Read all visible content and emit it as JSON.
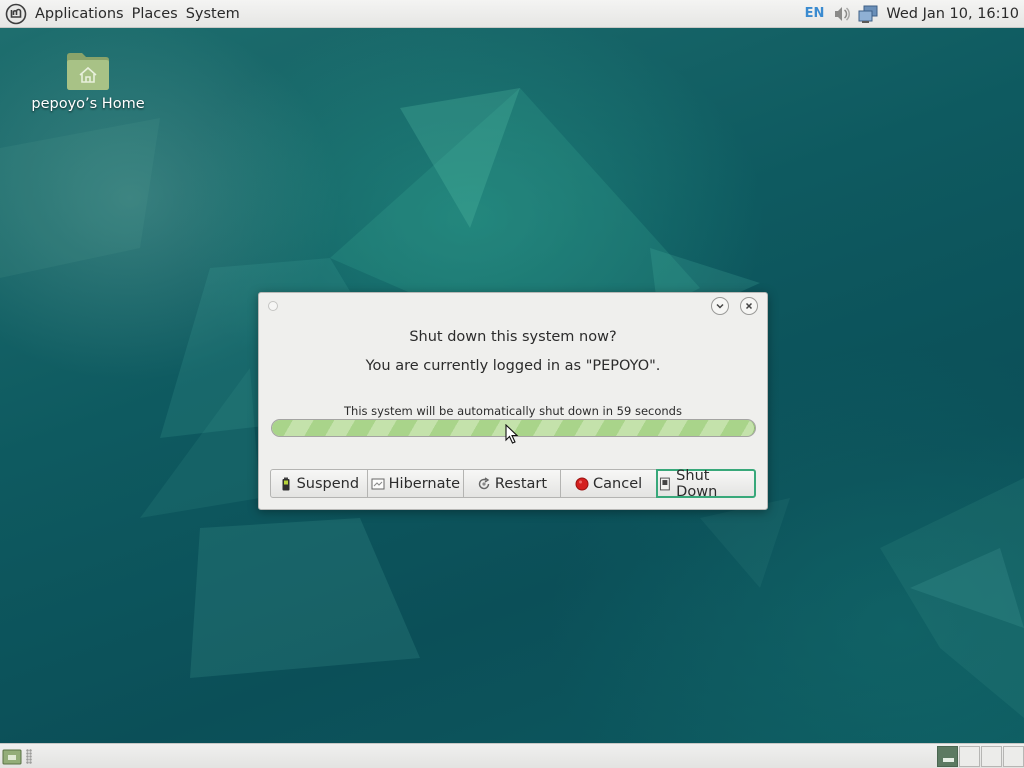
{
  "top_panel": {
    "menus": [
      "Applications",
      "Places",
      "System"
    ],
    "keyboard_layout": "EN",
    "clock": "Wed Jan 10, 16:10",
    "icons": [
      "mint-menu-icon",
      "volume-icon",
      "network-icon"
    ]
  },
  "desktop": {
    "icons": [
      {
        "label": "pepoyo’s Home",
        "icon": "home-folder-icon"
      }
    ]
  },
  "dialog": {
    "question": "Shut down this system now?",
    "logged_in_text": "You are currently logged in as \"PEPOYO\".",
    "countdown_text": "This system will be automatically shut down in 59 seconds",
    "progress_percent": 100,
    "buttons": [
      {
        "label": "Suspend",
        "icon": "suspend-battery-icon"
      },
      {
        "label": "Hibernate",
        "icon": "hibernate-icon"
      },
      {
        "label": "Restart",
        "icon": "restart-icon"
      },
      {
        "label": "Cancel",
        "icon": "cancel-red-dot-icon"
      },
      {
        "label": "Shut Down",
        "icon": "shutdown-icon",
        "default": true
      }
    ]
  },
  "bottom_panel": {
    "workspaces": 4,
    "active_workspace": 1
  },
  "colors": {
    "accent_green": "#38a87a",
    "progress_green": "#a9d48a",
    "desktop_teal": "#0f5a5e",
    "cancel_red": "#d4201e"
  }
}
